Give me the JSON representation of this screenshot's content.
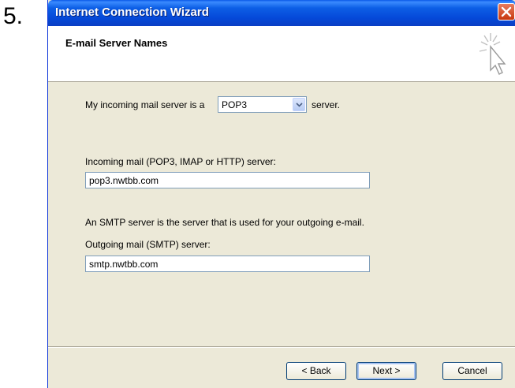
{
  "step_number": "5.",
  "window": {
    "title": "Internet Connection Wizard"
  },
  "header": {
    "title": "E-mail Server Names"
  },
  "form": {
    "incoming_prefix": "My incoming mail server is a",
    "server_type": "POP3",
    "incoming_suffix": "server.",
    "incoming_label": "Incoming mail (POP3, IMAP or HTTP) server:",
    "incoming_value": "pop3.nwtbb.com",
    "smtp_info": "An SMTP server is the server that is used for your outgoing e-mail.",
    "outgoing_label": "Outgoing mail (SMTP) server:",
    "outgoing_value": "smtp.nwtbb.com"
  },
  "buttons": {
    "back": "< Back",
    "next": "Next >",
    "cancel": "Cancel"
  }
}
